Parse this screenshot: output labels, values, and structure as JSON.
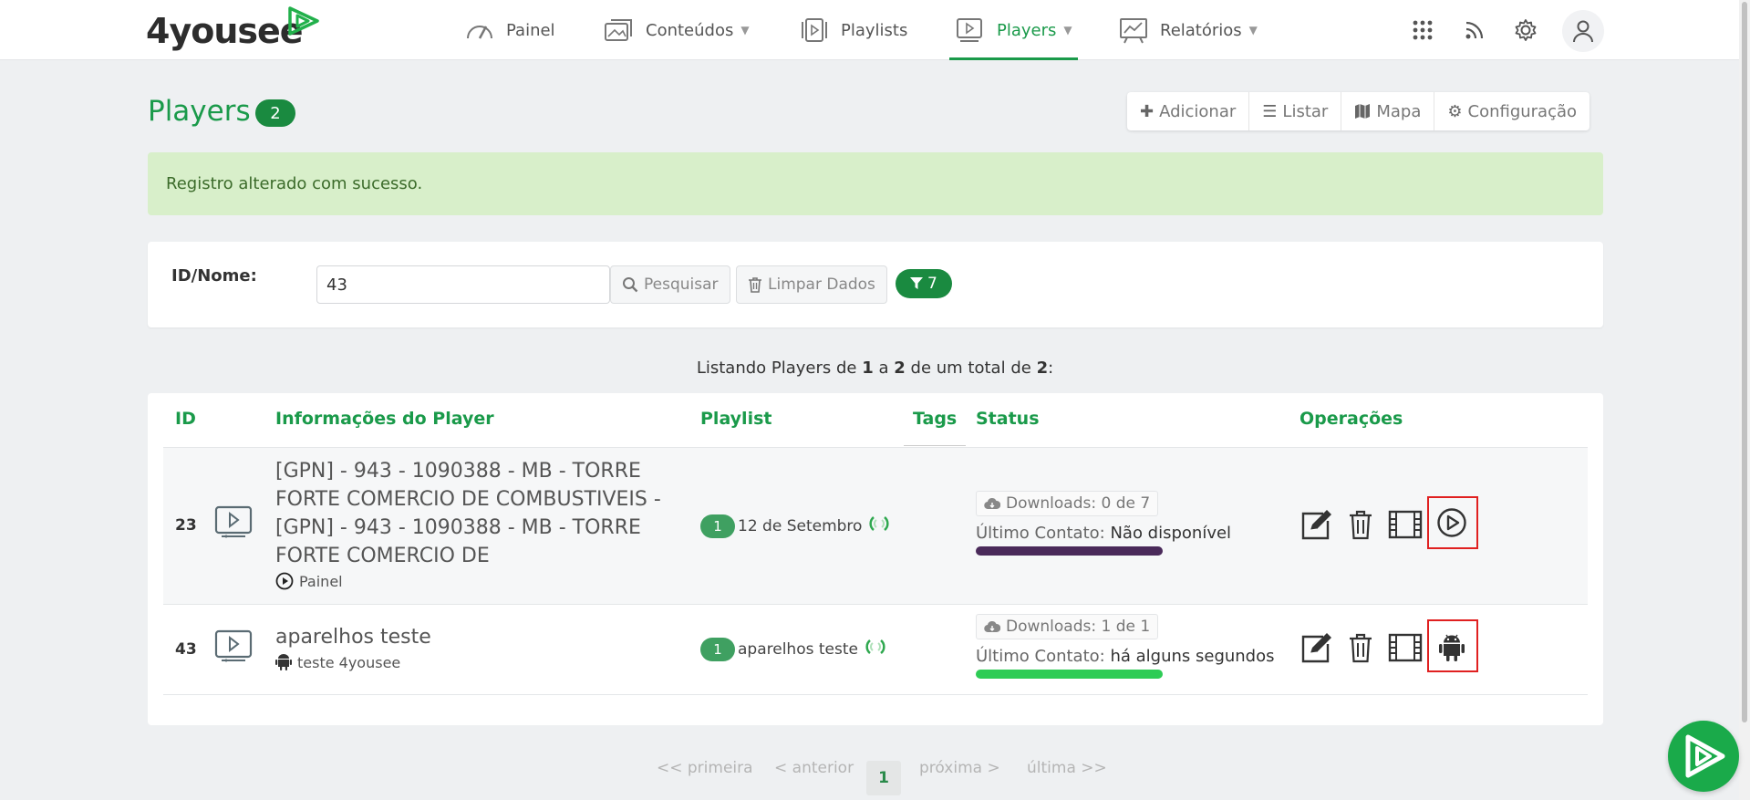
{
  "brand": {
    "name": "4yousee",
    "color": "#1a9a4a"
  },
  "nav": {
    "items": [
      {
        "label": "Painel",
        "icon": "gauge-icon"
      },
      {
        "label": "Conteúdos",
        "icon": "images-icon"
      },
      {
        "label": "Playlists",
        "icon": "playlists-icon"
      },
      {
        "label": "Players",
        "icon": "player-icon"
      },
      {
        "label": "Relatórios",
        "icon": "reports-icon"
      }
    ],
    "active": "Players"
  },
  "page": {
    "title": "Players",
    "count": "2"
  },
  "actions": {
    "add": "Adicionar",
    "list": "Listar",
    "map": "Mapa",
    "config": "Configuração"
  },
  "alert": {
    "message": "Registro alterado com sucesso."
  },
  "filter": {
    "label": "ID/Nome:",
    "value": "43",
    "search": "Pesquisar",
    "clear": "Limpar Dados",
    "count": "7"
  },
  "listing": {
    "prefix": "Listando Players de",
    "from": "1",
    "sep1": "a",
    "to": "2",
    "mid": "de um total de",
    "total": "2",
    "end": ":"
  },
  "table": {
    "headers": {
      "id": "ID",
      "info": "Informações do Player",
      "playlist": "Playlist",
      "tags": "Tags",
      "status": "Status",
      "ops": "Operações"
    },
    "rows": [
      {
        "id": "23",
        "name_lines": [
          "[GPN] - 943 - 1090388 - MB - TORRE",
          "FORTE COMERCIO DE COMBUSTIVEIS -",
          "[GPN] - 943 - 1090388 - MB - TORRE",
          "FORTE COMERCIO DE"
        ],
        "sub": "Painel",
        "sub_icon": "play-circle-icon",
        "playlist_count": "1",
        "playlist_name": "12 de Setembro",
        "downloads_label": "Downloads:",
        "downloads": "0 de 7",
        "contact_label": "Último Contato:",
        "contact": "Não disponível",
        "status_color": "#4a2a5a",
        "platform_icon": "play-circle-icon"
      },
      {
        "id": "43",
        "name_lines": [
          "aparelhos teste"
        ],
        "sub": "teste 4yousee",
        "sub_icon": "android-icon",
        "playlist_count": "1",
        "playlist_name": "aparelhos teste",
        "downloads_label": "Downloads:",
        "downloads": "1 de 1",
        "contact_label": "Último Contato:",
        "contact": "há alguns segundos",
        "status_color": "#2ecc55",
        "platform_icon": "android-icon"
      }
    ]
  },
  "pager": {
    "first": "<< primeira",
    "prev": "< anterior",
    "current": "1",
    "next": "próxima >",
    "last": "última >>"
  }
}
